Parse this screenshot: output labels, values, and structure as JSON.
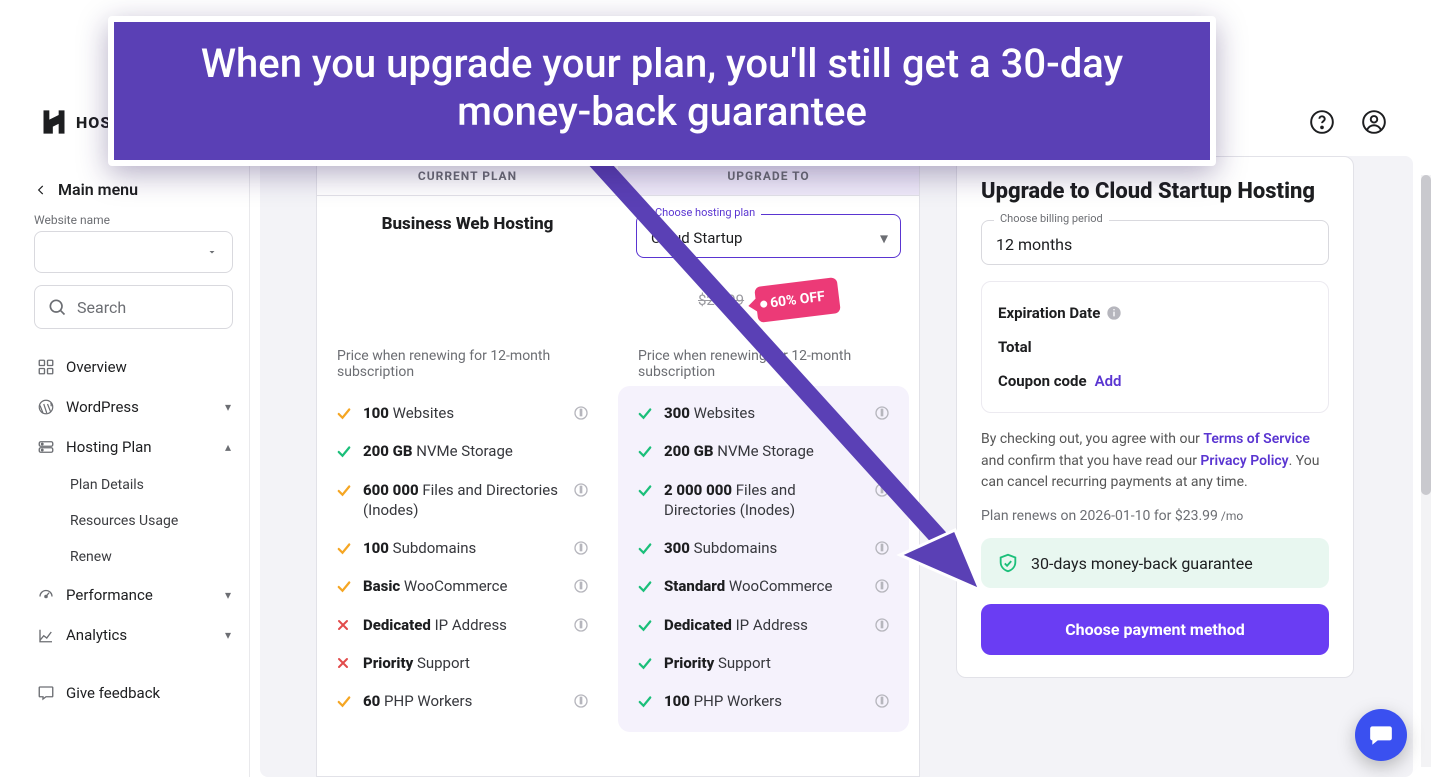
{
  "overlay": {
    "text": "When you upgrade your plan, you'll still get a 30-day money-back guarantee"
  },
  "brand": "HOS",
  "sidebar": {
    "back": "Main menu",
    "website_label": "Website name",
    "search_placeholder": "Search",
    "items": {
      "overview": "Overview",
      "wordpress": "WordPress",
      "hosting": "Hosting Plan",
      "plan_details": "Plan Details",
      "resources": "Resources Usage",
      "renew": "Renew",
      "performance": "Performance",
      "analytics": "Analytics",
      "feedback": "Give feedback"
    }
  },
  "compare": {
    "head_current": "CURRENT PLAN",
    "head_upgrade": "UPGRADE TO",
    "current_name": "Business Web Hosting",
    "select_legend": "Choose hosting plan",
    "select_value": "Cloud Startup",
    "old_price": "$24.99",
    "discount": "60% OFF",
    "renew_note": "Price when renewing for 12-month subscription",
    "renew_note2": "Price when renewing for 12-month subscription",
    "current_features": [
      {
        "icon": "ok-y",
        "bold": "100",
        "rest": " Websites",
        "info": true
      },
      {
        "icon": "ok-g",
        "bold": "200 GB",
        "rest": " NVMe Storage",
        "info": false
      },
      {
        "icon": "ok-y",
        "bold": "600 000",
        "rest": " Files and Directories (Inodes)",
        "info": true
      },
      {
        "icon": "ok-y",
        "bold": "100",
        "rest": " Subdomains",
        "info": true
      },
      {
        "icon": "ok-y",
        "bold": "Basic",
        "rest": " WooCommerce",
        "info": true
      },
      {
        "icon": "no",
        "bold": "Dedicated",
        "rest": " IP Address",
        "info": true
      },
      {
        "icon": "no",
        "bold": "Priority",
        "rest": " Support",
        "info": false
      },
      {
        "icon": "ok-y",
        "bold": "60",
        "rest": " PHP Workers",
        "info": true
      }
    ],
    "upgrade_features": [
      {
        "icon": "ok-g",
        "bold": "300",
        "rest": " Websites",
        "info": true
      },
      {
        "icon": "ok-g",
        "bold": "200 GB",
        "rest": " NVMe Storage",
        "info": false
      },
      {
        "icon": "ok-g",
        "bold": "2 000 000",
        "rest": " Files and Directories (Inodes)",
        "info": true
      },
      {
        "icon": "ok-g",
        "bold": "300",
        "rest": " Subdomains",
        "info": true
      },
      {
        "icon": "ok-g",
        "bold": "Standard",
        "rest": " WooCommerce",
        "info": true
      },
      {
        "icon": "ok-g",
        "bold": "Dedicated",
        "rest": " IP Address",
        "info": true
      },
      {
        "icon": "ok-g",
        "bold": "Priority",
        "rest": " Support",
        "info": false
      },
      {
        "icon": "ok-g",
        "bold": "100",
        "rest": " PHP Workers",
        "info": true
      }
    ]
  },
  "checkout": {
    "title": "Upgrade to Cloud Startup Hosting",
    "billing_legend": "Choose billing period",
    "billing_value": "12 months",
    "exp_label": "Expiration Date",
    "total_label": "Total",
    "coupon_label": "Coupon code",
    "coupon_link": "Add",
    "tos_pre": "By checking out, you agree with our ",
    "tos_link": "Terms of Service",
    "tos_mid": " and confirm that you have read our ",
    "pp_link": "Privacy Policy",
    "tos_post": ". You can cancel recurring payments at any time.",
    "renew_pre": "Plan renews on ",
    "renew_date": "2026-01-10",
    "renew_for": " for ",
    "renew_price": "$23.99",
    "renew_mo": " /mo",
    "guarantee": "30-days money-back guarantee",
    "cta": "Choose payment method"
  }
}
